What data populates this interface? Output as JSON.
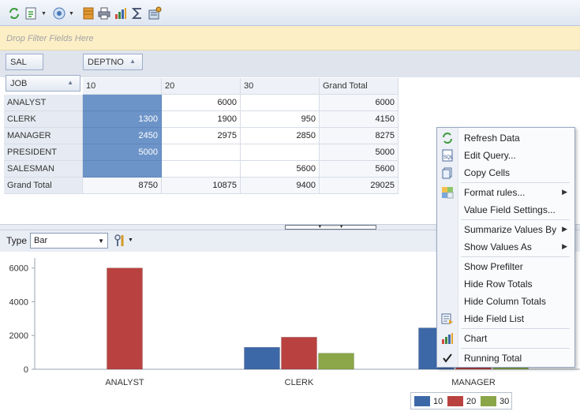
{
  "colors": {
    "series_10": "#3d68a8",
    "series_20": "#b94240",
    "series_30": "#8aa648",
    "selection": "#6d94c8"
  },
  "toolbar": {
    "icons": [
      "refresh-icon",
      "export-icon",
      "chart-wizard-icon",
      "layout-icon",
      "print-icon",
      "chart-icon",
      "sum-icon",
      "settings-icon"
    ]
  },
  "filter_area": {
    "placeholder": "Drop Filter Fields Here"
  },
  "fields": {
    "data_field": "SAL",
    "column_field": "DEPTNO",
    "row_field": "JOB"
  },
  "pivot": {
    "columns": [
      "10",
      "20",
      "30",
      "Grand Total"
    ],
    "rows": [
      {
        "label": "ANALYST",
        "cells": [
          "",
          "6000",
          "",
          "6000"
        ]
      },
      {
        "label": "CLERK",
        "cells": [
          "1300",
          "1900",
          "950",
          "4150"
        ]
      },
      {
        "label": "MANAGER",
        "cells": [
          "2450",
          "2975",
          "2850",
          "8275"
        ]
      },
      {
        "label": "PRESIDENT",
        "cells": [
          "5000",
          "",
          "",
          "5000"
        ]
      },
      {
        "label": "SALESMAN",
        "cells": [
          "",
          "",
          "5600",
          "5600"
        ]
      },
      {
        "label": "Grand Total",
        "cells": [
          "8750",
          "10875",
          "9400",
          "29025"
        ]
      }
    ]
  },
  "chart_toolbar": {
    "type_label": "Type",
    "type_value": "Bar"
  },
  "context_menu": {
    "items": [
      {
        "label": "Refresh Data",
        "icon": "refresh-icon",
        "submenu": false
      },
      {
        "label": "Edit Query...",
        "icon": "sql-icon",
        "submenu": false
      },
      {
        "label": "Copy Cells",
        "icon": "copy-icon",
        "submenu": false
      },
      {
        "label": "Format rules...",
        "icon": "format-rules-icon",
        "submenu": true
      },
      {
        "label": "Value Field Settings...",
        "icon": "",
        "submenu": false
      },
      {
        "label": "Summarize Values By",
        "icon": "",
        "submenu": true
      },
      {
        "label": "Show Values As",
        "icon": "",
        "submenu": true
      },
      {
        "label": "Show Prefilter",
        "icon": "",
        "submenu": false
      },
      {
        "label": "Hide Row Totals",
        "icon": "",
        "submenu": false
      },
      {
        "label": "Hide Column Totals",
        "icon": "",
        "submenu": false
      },
      {
        "label": "Hide Field List",
        "icon": "field-list-icon",
        "submenu": false
      },
      {
        "label": "Chart",
        "icon": "chart-icon",
        "submenu": false
      },
      {
        "label": "Running Total",
        "icon": "checkmark-icon",
        "submenu": false
      }
    ]
  },
  "chart_data": {
    "type": "bar",
    "categories": [
      "ANALYST",
      "CLERK",
      "MANAGER"
    ],
    "series": [
      {
        "name": "10",
        "values": [
          0,
          1300,
          2450
        ]
      },
      {
        "name": "20",
        "values": [
          6000,
          1900,
          2975
        ]
      },
      {
        "name": "30",
        "values": [
          0,
          950,
          2850
        ]
      }
    ],
    "y_ticks": [
      "0",
      "2000",
      "4000",
      "6000"
    ],
    "ylim": [
      0,
      6500
    ],
    "legend": "bottom-right",
    "grid": false
  }
}
